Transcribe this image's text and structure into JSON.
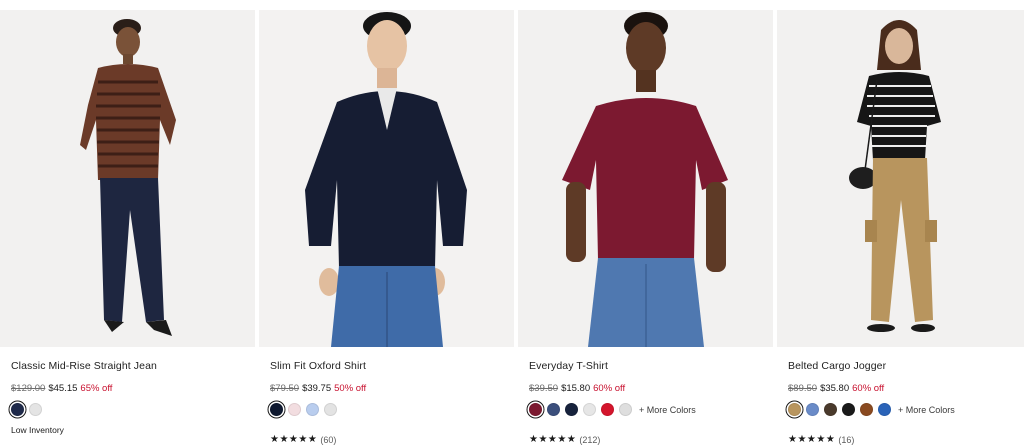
{
  "products": [
    {
      "name": "Classic Mid-Rise Straight Jean",
      "original_price": "$129.00",
      "sale_price": "$45.15",
      "discount": "65% off",
      "swatches": [
        "#1f2a4a",
        "#e4e4e4"
      ],
      "more_colors": "",
      "inventory": "Low Inventory",
      "stars": "",
      "reviews": ""
    },
    {
      "name": "Slim Fit Oxford Shirt",
      "original_price": "$79.50",
      "sale_price": "$39.75",
      "discount": "50% off",
      "swatches": [
        "#0f1930",
        "#f2dde0",
        "#b9cdee",
        "#e3e3e3"
      ],
      "more_colors": "",
      "inventory": "",
      "stars": "★★★★★",
      "reviews": "(60)"
    },
    {
      "name": "Everyday T-Shirt",
      "original_price": "$39.50",
      "sale_price": "$15.80",
      "discount": "60% off",
      "swatches": [
        "#7c1930",
        "#3b4f7c",
        "#17223c",
        "#e6e6e6",
        "#d4152c",
        "#dedede"
      ],
      "more_colors": "+ More Colors",
      "inventory": "",
      "stars": "★★★★★",
      "reviews": "(212)"
    },
    {
      "name": "Belted Cargo Jogger",
      "original_price": "$89.50",
      "sale_price": "$35.80",
      "discount": "60% off",
      "swatches": [
        "#b8955e",
        "#6a8bc8",
        "#4a3a2c",
        "#1a1a1a",
        "#8a4a20",
        "#2a63b8"
      ],
      "more_colors": "+ More Colors",
      "inventory": "",
      "stars": "★★★★★",
      "reviews": "(16)"
    }
  ],
  "colors": {
    "discount": "#c8102e",
    "photo_bg": "#f1f1f1"
  }
}
